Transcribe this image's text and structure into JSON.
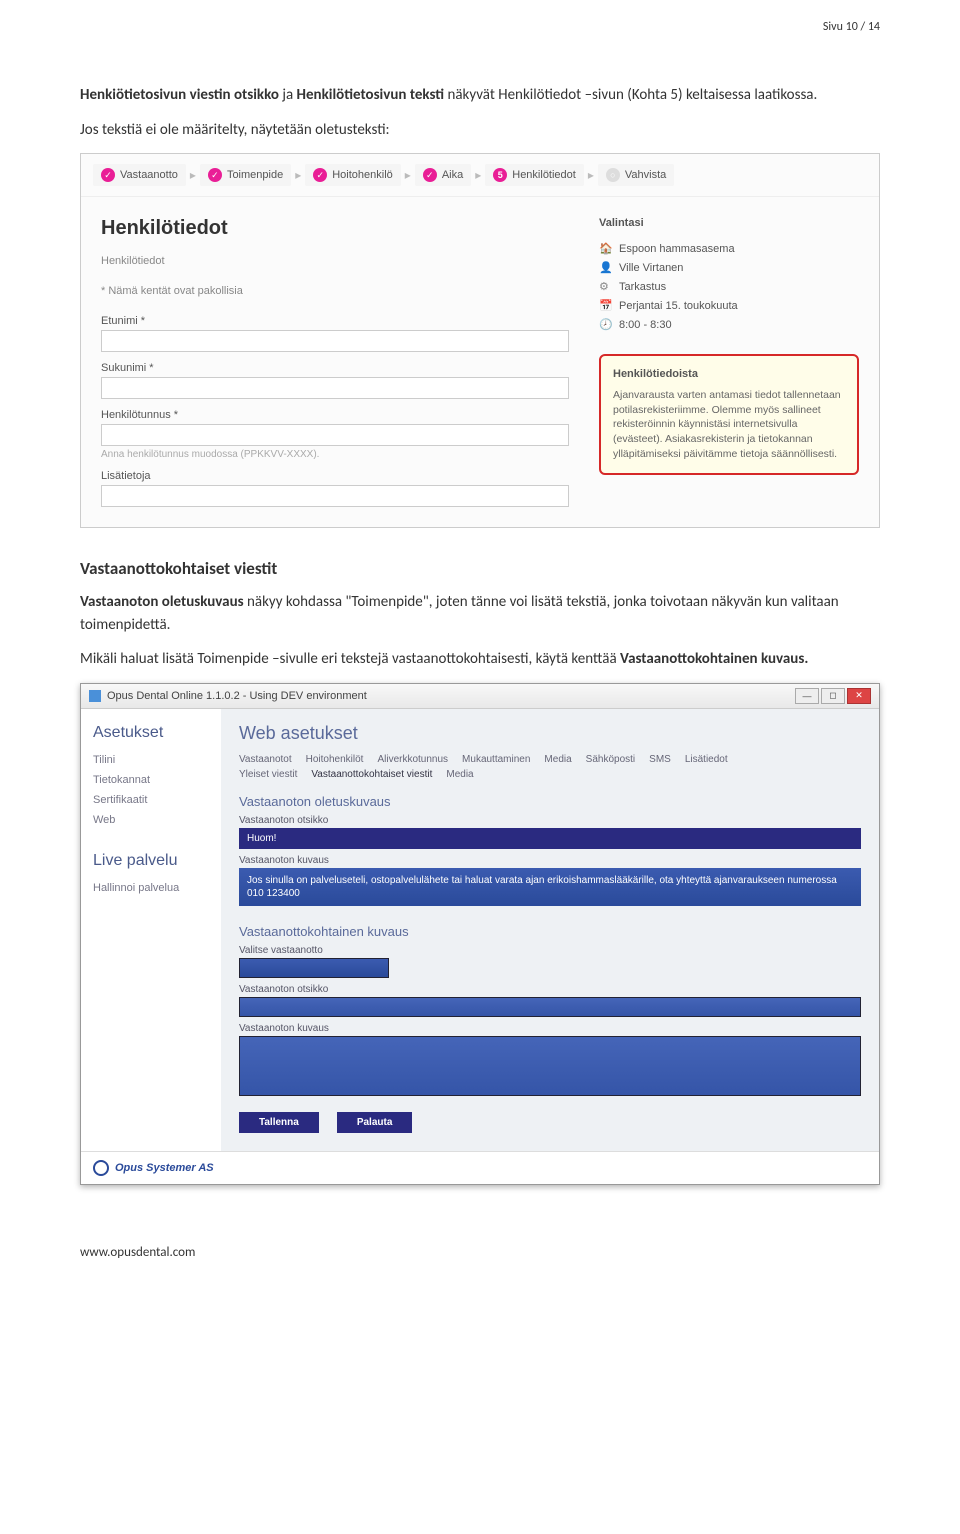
{
  "page": {
    "header": "Sivu 10 / 14",
    "footer": "www.opusdental.com"
  },
  "para1": {
    "t1": "Henkiötietosivun viestin otsikko",
    "t2": " ja ",
    "t3": "Henkilötietosivun teksti",
    "t4": " näkyvät Henkilötiedot –sivun (Kohta 5) keltaisessa laatikossa."
  },
  "para2": "Jos tekstiä ei ole määritelty, näytetään oletusteksti:",
  "shot1": {
    "crumbs": {
      "c1": "Vastaanotto",
      "c2": "Toimenpide",
      "c3": "Hoitohenkilö",
      "c4": "Aika",
      "c5num": "5",
      "c5": "Henkilötiedot",
      "c6": "Vahvista"
    },
    "title": "Henkilötiedot",
    "sublabel": "Henkilötiedot",
    "reqnote": "* Nämä kentät ovat pakollisia",
    "etunimi": "Etunimi *",
    "sukunimi": "Sukunimi *",
    "hetu": "Henkilötunnus *",
    "hetu_hint": "Anna henkilötunnus muodossa (PPKKVV-XXXX).",
    "lisat": "Lisätietoja",
    "valintasi": "Valintasi",
    "sel": {
      "loc": "Espoon hammasasema",
      "person": "Ville Virtanen",
      "op": "Tarkastus",
      "date": "Perjantai 15. toukokuuta",
      "time": "8:00 - 8:30"
    },
    "info": {
      "title": "Henkilötiedoista",
      "text": "Ajanvarausta varten antamasi tiedot tallennetaan potilasrekisteriimme. Olemme myös sallineet rekisteröinnin käynnistäsi internetsivulla (evästeet). Asiakasrekisterin ja tietokannan ylläpitämiseksi päivitämme tietoja säännöllisesti."
    }
  },
  "section2": {
    "heading": "Vastaanottokohtaiset viestit",
    "p1a": "Vastaanoton oletuskuvaus",
    "p1b": " näkyy kohdassa \"Toimenpide\", joten tänne voi lisätä tekstiä, jonka toivotaan näkyvän kun valitaan toimenpidettä.",
    "p2a": "Mikäli haluat lisätä Toimenpide –sivulle eri tekstejä vastaanottokohtaisesti, käytä kenttää ",
    "p2b": "Vastaanottokohtainen kuvaus."
  },
  "shot2": {
    "wintitle": "Opus Dental Online 1.1.0.2 - Using DEV environment",
    "side": {
      "h1": "Asetukset",
      "l1": "Tilini",
      "l2": "Tietokannat",
      "l3": "Sertifikaatit",
      "l4": "Web",
      "h2": "Live palvelu",
      "l5": "Hallinnoi palvelua"
    },
    "main": {
      "title": "Web asetukset",
      "tabs1": {
        "t1": "Vastaanotot",
        "t2": "Hoitohenkilöt",
        "t3": "Aliverkkotunnus",
        "t4": "Mukauttaminen",
        "t5": "Media",
        "t6": "Sähköposti",
        "t7": "SMS",
        "t8": "Lisätiedot"
      },
      "tabs2": {
        "t1": "Yleiset viestit",
        "t2": "Vastaanottokohtaiset viestit",
        "t3": "Media"
      },
      "sec1": "Vastaanoton oletuskuvaus",
      "lbl_otsikko": "Vastaanoton otsikko",
      "val_huom": "Huom!",
      "lbl_kuvaus": "Vastaanoton kuvaus",
      "val_kuvaus": "Jos sinulla on palveluseteli, ostopalvelulähete tai haluat varata ajan erikoishammaslääkärille, ota yhteyttä ajanvaraukseen numerossa 010 123400",
      "sec2": "Vastaanottokohtainen kuvaus",
      "lbl_valitse": "Valitse vastaanotto",
      "lbl_otsikko2": "Vastaanoton otsikko",
      "lbl_kuvaus2": "Vastaanoton kuvaus",
      "btn_save": "Tallenna",
      "btn_reset": "Palauta",
      "footer_brand": "Opus Systemer AS"
    }
  }
}
